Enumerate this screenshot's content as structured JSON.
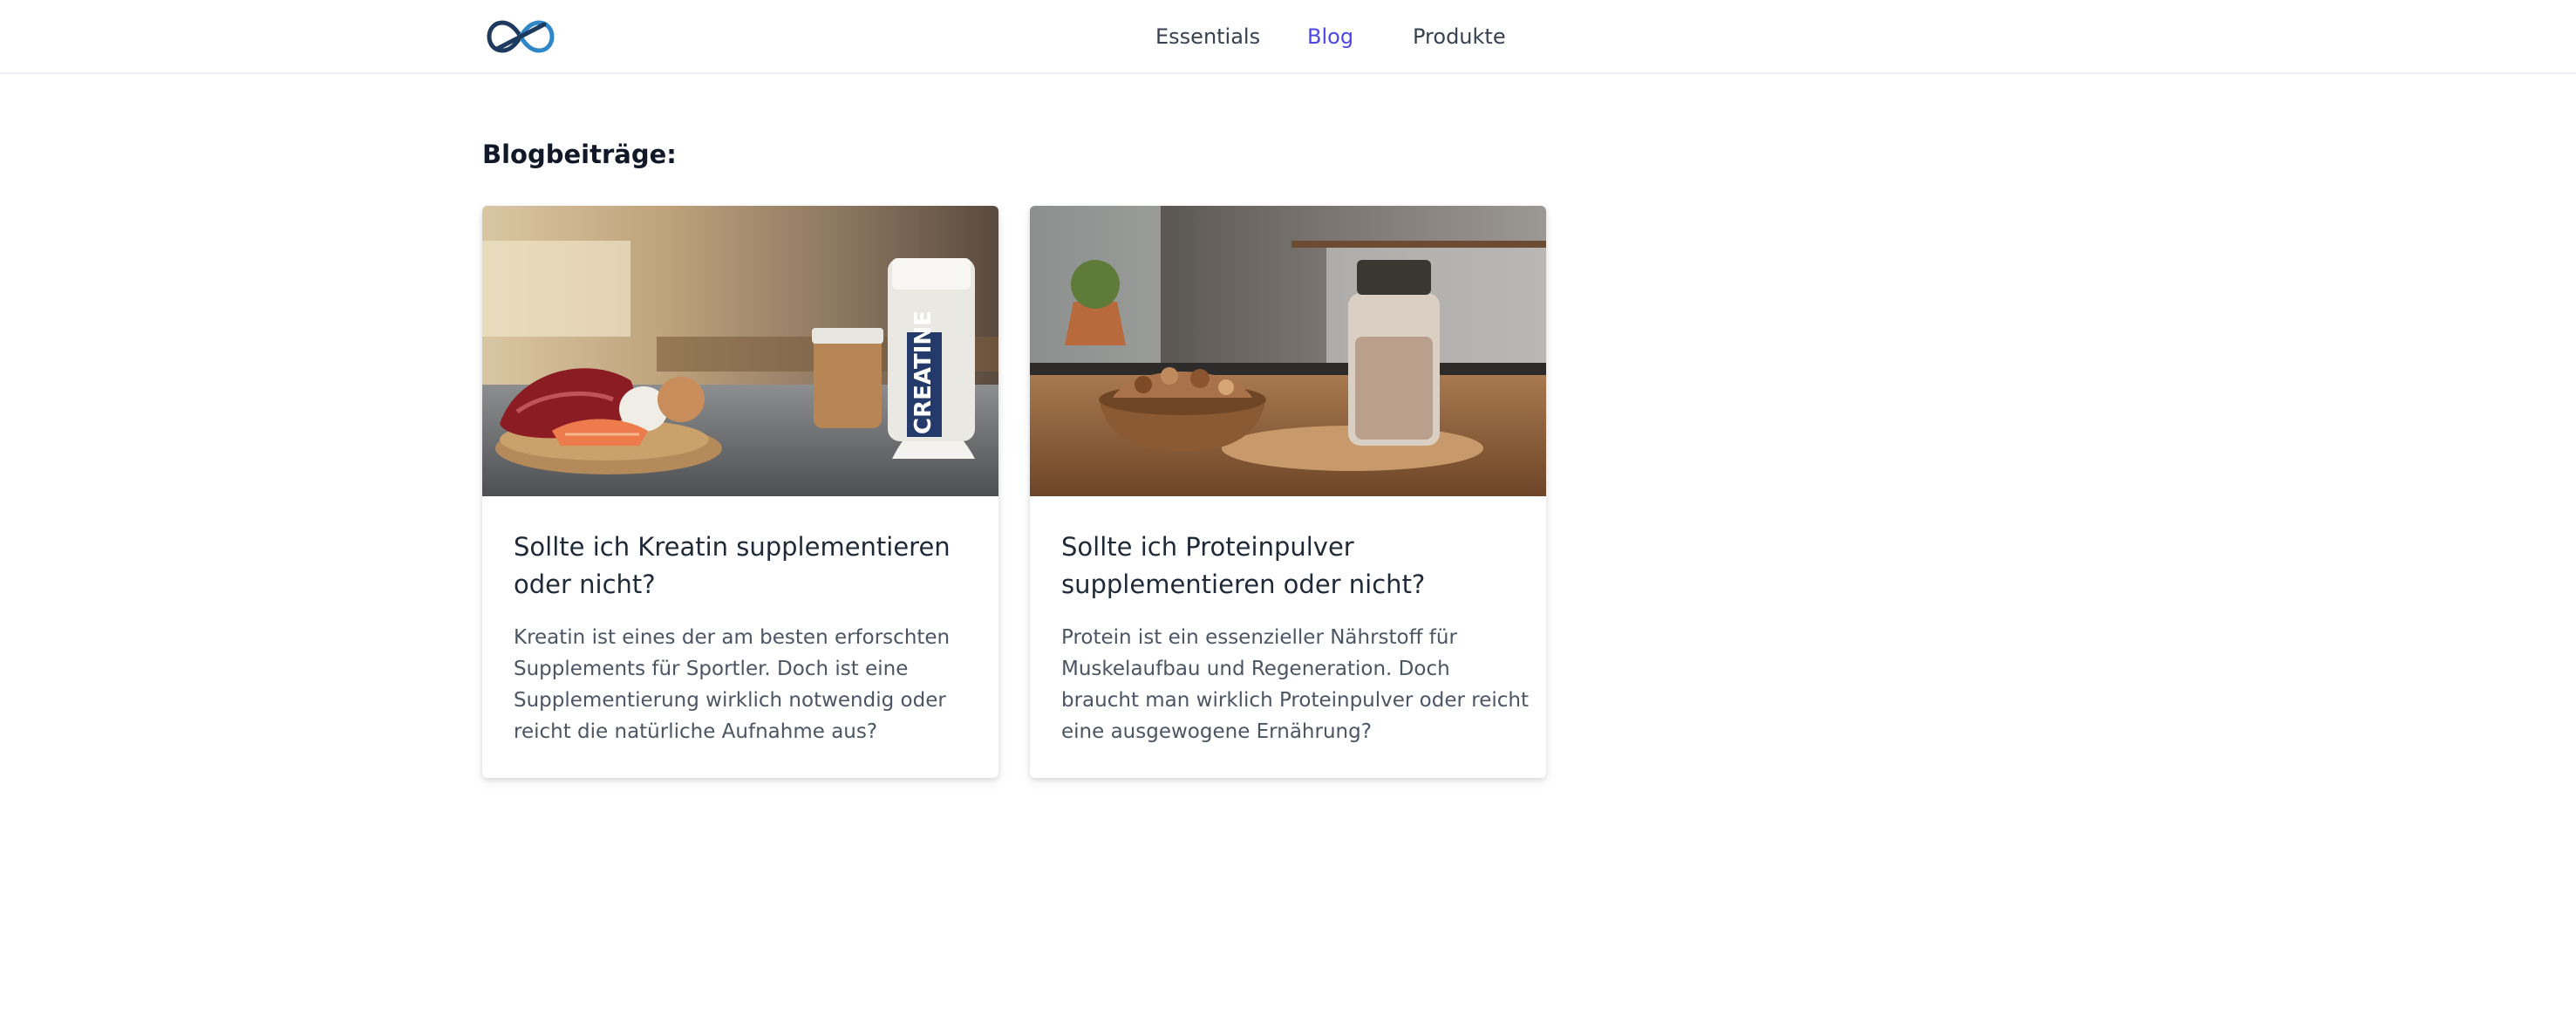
{
  "brand": {
    "logo_icon": "infinity-logo-icon",
    "color_dark": "#1e3a5f",
    "color_light": "#2f86c8"
  },
  "nav": {
    "items": [
      {
        "label": "Essentials",
        "active": false
      },
      {
        "label": "Blog",
        "active": true
      },
      {
        "label": "Produkte",
        "active": false
      }
    ],
    "active_color": "#4f46e5"
  },
  "main": {
    "section_title": "Blogbeiträge:",
    "posts": [
      {
        "image_icon": "creatine-food-photo",
        "title": "Sollte ich Kreatin supplementieren oder nicht?",
        "excerpt": "Kreatin ist eines der am besten erforschten Supplements für Sportler. Doch ist eine Supplementierung wirklich notwendig oder reicht die natürliche Aufnahme aus?",
        "image_text": "CREATINE"
      },
      {
        "image_icon": "protein-nuts-photo",
        "title": "Sollte ich Proteinpulver supplementieren oder nicht?",
        "excerpt": "Protein ist ein essenzieller Nährstoff für Muskelaufbau und Regeneration. Doch braucht man wirklich Proteinpulver oder reicht eine ausgewogene Ernährung?"
      }
    ]
  }
}
